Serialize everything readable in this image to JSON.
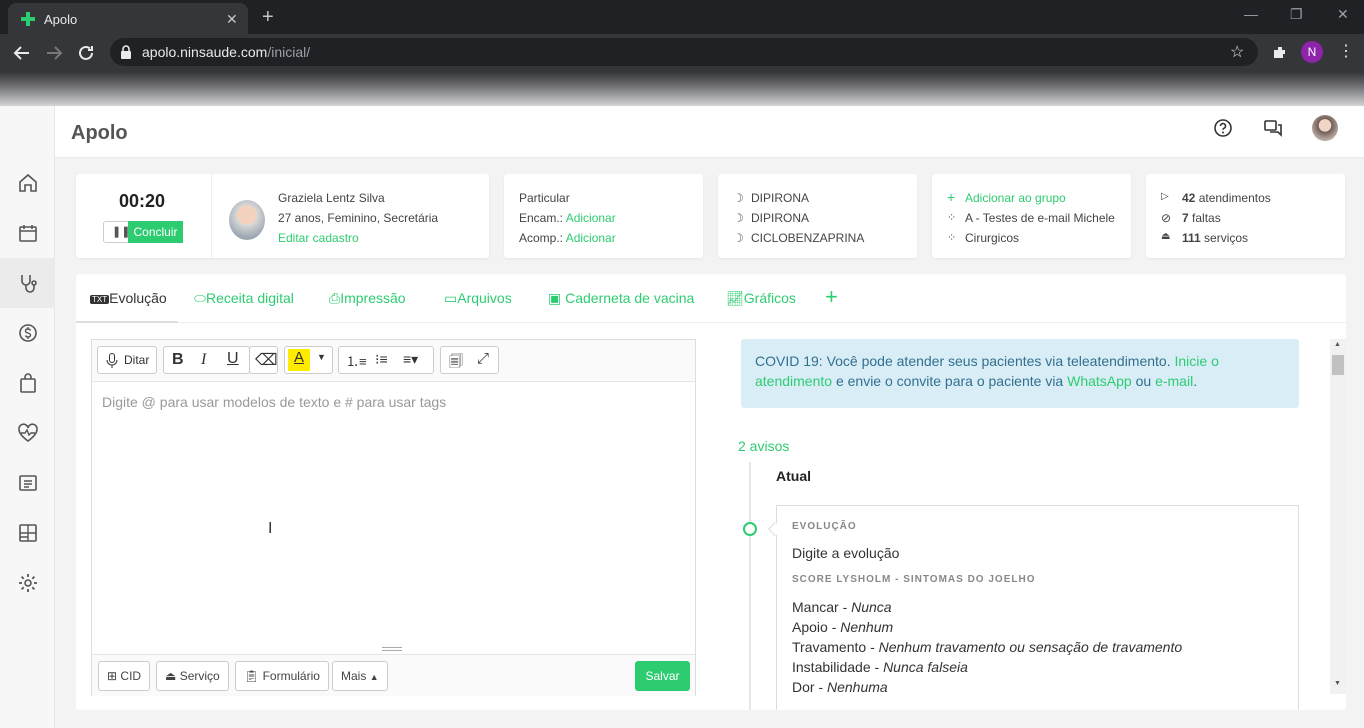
{
  "browser": {
    "tab_title": "Apolo",
    "url_host": "apolo.ninsaude.com",
    "url_path": "/inicial/",
    "profile_initial": "N"
  },
  "app": {
    "title": "Apolo",
    "brand_color": "#2ecc71"
  },
  "timer": {
    "time": "00:20",
    "conclude_label": "Concluir"
  },
  "patient": {
    "name": "Graziela Lentz Silva",
    "details": "27 anos, Feminino, Secretária",
    "edit_link": "Editar cadastro"
  },
  "insurance": {
    "plan": "Particular",
    "encam_label": "Encam.:",
    "encam_action": "Adicionar",
    "acomp_label": "Acomp.:",
    "acomp_action": "Adicionar"
  },
  "medications": [
    "DIPIRONA",
    "DIPIRONA",
    "CICLOBENZAPRINA"
  ],
  "groups": {
    "add_label": "Adicionar ao grupo",
    "items": [
      "A - Testes de e-mail Michele",
      "Cirurgicos"
    ]
  },
  "stats": {
    "attendances_count": "42",
    "attendances_label": "atendimentos",
    "absences_count": "7",
    "absences_label": "faltas",
    "services_count": "111",
    "services_label": "serviços"
  },
  "tabs": {
    "evolution": "Evolução",
    "prescription": "Receita digital",
    "print": "Impressão",
    "files": "Arquivos",
    "vaccine": "Caderneta de vacina",
    "charts": "Gráficos"
  },
  "editor": {
    "dictate_label": "Ditar",
    "placeholder": "Digite @ para usar modelos de texto e # para usar tags",
    "cid_label": "CID",
    "service_label": "Serviço",
    "form_label": "Formulário",
    "more_label": "Mais",
    "save_label": "Salvar"
  },
  "alert": {
    "text1": "COVID 19: Você pode atender seus pacientes via teleatendimento.",
    "link1": "Inicie o atendimento",
    "text2": "e envie o convite para o paciente via",
    "link2": "WhatsApp",
    "text3": "ou",
    "link3": "e-mail",
    "text4": "."
  },
  "timeline": {
    "notices": "2 avisos",
    "current": "Atual",
    "section1_title": "EVOLUÇÃO",
    "section1_text": "Digite a evolução",
    "section2_title": "SCORE LYSHOLM - SINTOMAS DO JOELHO",
    "items": [
      {
        "label": "Mancar - ",
        "value": "Nunca"
      },
      {
        "label": "Apoio - ",
        "value": "Nenhum"
      },
      {
        "label": "Travamento - ",
        "value": "Nenhum travamento ou sensação de travamento"
      },
      {
        "label": "Instabilidade - ",
        "value": "Nunca falseia"
      },
      {
        "label": "Dor - ",
        "value": "Nenhuma"
      }
    ]
  }
}
